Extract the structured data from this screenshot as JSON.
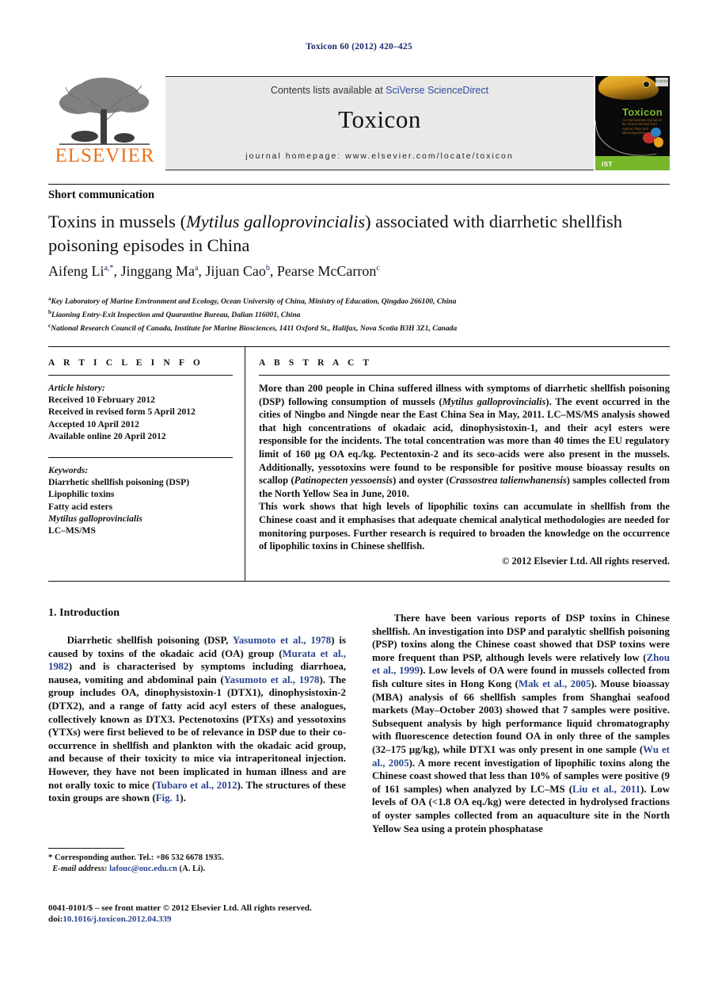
{
  "running_head": "Toxicon 60 (2012) 420–425",
  "masthead": {
    "contents_prefix": "Contents lists available at ",
    "contents_link": "SciVerse ScienceDirect",
    "journal_name": "Toxicon",
    "homepage": "journal homepage: www.elsevier.com/locate/toxicon",
    "publisher_logo_text": "ELSEVIER",
    "cover": {
      "title": "Toxicon",
      "subtitle": "An International Journal on the Toxins Derived from Animal, Plant and Microorganisms",
      "society_mark": "IST",
      "publisher_mark": "ELSEVIER"
    }
  },
  "article": {
    "type": "Short communication",
    "title_part1": "Toxins in mussels (",
    "title_species": "Mytilus galloprovincialis",
    "title_part2": ") associated with diarrhetic shellfish poisoning episodes in China",
    "authors": [
      {
        "name": "Aifeng Li",
        "marks": "a,*"
      },
      {
        "name": "Jinggang Ma",
        "marks": "a"
      },
      {
        "name": "Jijuan Cao",
        "marks": "b"
      },
      {
        "name": "Pearse McCarron",
        "marks": "c"
      }
    ],
    "affiliations": [
      {
        "mark": "a",
        "text": "Key Laboratory of Marine Environment and Ecology, Ocean University of China, Ministry of Education, Qingdao 266100, China"
      },
      {
        "mark": "b",
        "text": "Liaoning Entry-Exit Inspection and Quarantine Bureau, Dalian 116001, China"
      },
      {
        "mark": "c",
        "text": "National Research Council of Canada, Institute for Marine Biosciences, 1411 Oxford St., Halifax, Nova Scotia B3H 3Z1, Canada"
      }
    ]
  },
  "article_info": {
    "heading": "A R T I C L E  I N F O",
    "history_label": "Article history:",
    "history": [
      "Received 10 February 2012",
      "Received in revised form 5 April 2012",
      "Accepted 10 April 2012",
      "Available online 20 April 2012"
    ],
    "keywords_label": "Keywords:",
    "keywords": [
      "Diarrhetic shellfish poisoning (DSP)",
      "Lipophilic toxins",
      "Fatty acid esters",
      "Mytilus galloprovincialis",
      "LC–MS/MS"
    ],
    "keyword_italic_index": 3
  },
  "abstract": {
    "heading": "A B S T R A C T",
    "para1_a": "More than 200 people in China suffered illness with symptoms of diarrhetic shellfish poisoning (DSP) following consumption of mussels (",
    "para1_species1": "Mytilus galloprovincialis",
    "para1_b": "). The event occurred in the cities of Ningbo and Ningde near the East China Sea in May, 2011. LC–MS/MS analysis showed that high concentrations of okadaic acid, dinophysistoxin-1, and their acyl esters were responsible for the incidents. The total concentration was more than 40 times the EU regulatory limit of 160 μg OA eq./kg. Pectentoxin-2 and its seco-acids were also present in the mussels. Additionally, yessotoxins were found to be responsible for positive mouse bioassay results on scallop (",
    "para1_species2": "Patinopecten yessoensis",
    "para1_c": ") and oyster (",
    "para1_species3": "Crassostrea talienwhanensis",
    "para1_d": ") samples collected from the North Yellow Sea in June, 2010.",
    "para2": "This work shows that high levels of lipophilic toxins can accumulate in shellfish from the Chinese coast and it emphasises that adequate chemical analytical methodologies are needed for monitoring purposes. Further research is required to broaden the knowledge on the occurrence of lipophilic toxins in Chinese shellfish.",
    "copyright": "© 2012 Elsevier Ltd. All rights reserved."
  },
  "body": {
    "section_number_title": "1. Introduction",
    "left_column": {
      "seg1": "Diarrhetic shellfish poisoning (DSP, ",
      "ref1": "Yasumoto et al., 1978",
      "seg2": ") is caused by toxins of the okadaic acid (OA) group (",
      "ref2": "Murata et al., 1982",
      "seg3": ") and is characterised by symptoms including diarrhoea, nausea, vomiting and abdominal pain (",
      "ref3": "Yasumoto et al., 1978",
      "seg4": "). The group includes OA, dinophysistoxin-1 (DTX1), dinophysistoxin-2 (DTX2), and a range of fatty acid acyl esters of these analogues, collectively known as DTX3. Pectenotoxins (PTXs) and yessotoxins (YTXs) were first believed to be of relevance in DSP due to their co-occurrence in shellfish and plankton with the okadaic acid group, and because of their toxicity to mice via intraperitoneal injection. However, they have not been implicated in human illness and are not orally toxic to mice (",
      "ref4": "Tubaro et al., 2012",
      "seg5": "). The structures of these toxin groups are shown (",
      "ref5": "Fig. 1",
      "seg6": ")."
    },
    "right_column": {
      "seg1": "There have been various reports of DSP toxins in Chinese shellfish. An investigation into DSP and paralytic shellfish poisoning (PSP) toxins along the Chinese coast showed that DSP toxins were more frequent than PSP, although levels were relatively low (",
      "ref1": "Zhou et al., 1999",
      "seg2": "). Low levels of OA were found in mussels collected from fish culture sites in Hong Kong (",
      "ref2": "Mak et al., 2005",
      "seg3": "). Mouse bioassay (MBA) analysis of 66 shellfish samples from Shanghai seafood markets (May–October 2003) showed that 7 samples were positive. Subsequent analysis by high performance liquid chromatography with fluorescence detection found OA in only three of the samples (32–175 μg/kg), while DTX1 was only present in one sample (",
      "ref3": "Wu et al., 2005",
      "seg4": "). A more recent investigation of lipophilic toxins along the Chinese coast showed that less than 10% of samples were positive (9 of 161 samples) when analyzed by LC–MS (",
      "ref4": "Liu et al., 2011",
      "seg5": "). Low levels of OA (<1.8 OA eq./kg) were detected in hydrolysed fractions of oyster samples collected from an aquaculture site in the North Yellow Sea using a protein phosphatase"
    }
  },
  "footnotes": {
    "corresponding": "* Corresponding author. Tel.: +86 532 6678 1935.",
    "email_label": "E-mail address:",
    "email": "lafouc@ouc.edu.cn",
    "email_suffix": "(A. Li).",
    "imprint_line1": "0041-0101/$ – see front matter © 2012 Elsevier Ltd. All rights reserved.",
    "imprint_doi_label": "doi:",
    "imprint_doi": "10.1016/j.toxicon.2012.04.339"
  },
  "colors": {
    "link_blue": "#2b4593",
    "running_head_blue": "#1a2a6c",
    "elsevier_orange": "#E9711C",
    "cover_green": "#76b82a",
    "band_gray": "#e9e9e9"
  }
}
